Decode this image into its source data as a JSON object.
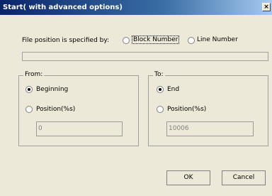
{
  "window": {
    "title": "Start( with advanced options)",
    "close_glyph": "×"
  },
  "file_position": {
    "label": "File position is specified by:",
    "options": [
      {
        "label": "Block Number",
        "selected": false
      },
      {
        "label": "Line Number",
        "selected": false
      }
    ]
  },
  "from": {
    "title": "From:",
    "beginning_label": "Beginning",
    "position_label": "Position(%s)",
    "position_value": "0",
    "selected": "beginning"
  },
  "to": {
    "title": "To:",
    "end_label": "End",
    "position_label": "Position(%s)",
    "position_value": "10006",
    "selected": "end"
  },
  "buttons": {
    "ok": "OK",
    "cancel": "Cancel"
  }
}
